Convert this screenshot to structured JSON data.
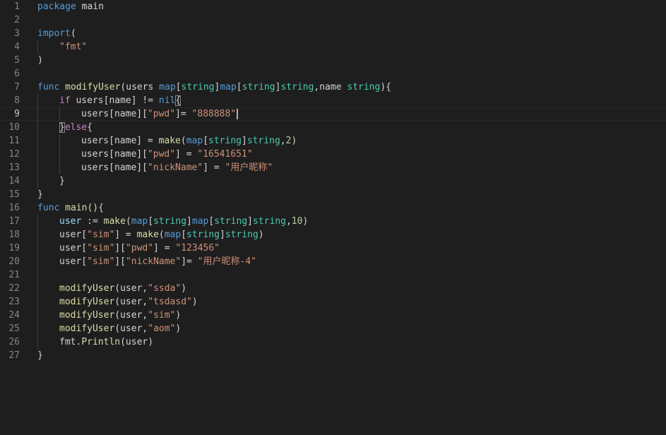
{
  "editor": {
    "current_line": 9,
    "lines": [
      {
        "no": "1",
        "indent": 0,
        "tokens": [
          {
            "t": "package",
            "c": "kw"
          },
          {
            "t": " main",
            "c": "plain"
          }
        ]
      },
      {
        "no": "2",
        "indent": 0,
        "tokens": []
      },
      {
        "no": "3",
        "indent": 0,
        "tokens": [
          {
            "t": "import",
            "c": "kw"
          },
          {
            "t": "(",
            "c": "plain"
          }
        ]
      },
      {
        "no": "4",
        "indent": 1,
        "tokens": [
          {
            "t": "\"fmt\"",
            "c": "str"
          }
        ]
      },
      {
        "no": "5",
        "indent": 0,
        "tokens": [
          {
            "t": ")",
            "c": "plain"
          }
        ]
      },
      {
        "no": "6",
        "indent": 0,
        "tokens": []
      },
      {
        "no": "7",
        "indent": 0,
        "tokens": [
          {
            "t": "func ",
            "c": "kw"
          },
          {
            "t": "modifyUser",
            "c": "fn"
          },
          {
            "t": "(",
            "c": "plain"
          },
          {
            "t": "users ",
            "c": "plain"
          },
          {
            "t": "map",
            "c": "kw"
          },
          {
            "t": "[",
            "c": "plain"
          },
          {
            "t": "string",
            "c": "ty"
          },
          {
            "t": "]",
            "c": "plain"
          },
          {
            "t": "map",
            "c": "kw"
          },
          {
            "t": "[",
            "c": "plain"
          },
          {
            "t": "string",
            "c": "ty"
          },
          {
            "t": "]",
            "c": "plain"
          },
          {
            "t": "string",
            "c": "ty"
          },
          {
            "t": ",name ",
            "c": "plain"
          },
          {
            "t": "string",
            "c": "ty"
          },
          {
            "t": "){",
            "c": "plain"
          }
        ]
      },
      {
        "no": "8",
        "indent": 1,
        "tokens": [
          {
            "t": "if ",
            "c": "ctl"
          },
          {
            "t": "users[name] != ",
            "c": "plain"
          },
          {
            "t": "nil",
            "c": "kw"
          },
          {
            "t": "{",
            "c": "plain",
            "m": true
          }
        ]
      },
      {
        "no": "9",
        "indent": 2,
        "cursor": true,
        "tokens": [
          {
            "t": "users[name][",
            "c": "plain"
          },
          {
            "t": "\"pwd\"",
            "c": "str"
          },
          {
            "t": "]= ",
            "c": "plain"
          },
          {
            "t": "\"888888\"",
            "c": "str"
          }
        ]
      },
      {
        "no": "10",
        "indent": 1,
        "tokens": [
          {
            "t": "}",
            "c": "plain",
            "m": true
          },
          {
            "t": "else",
            "c": "ctl"
          },
          {
            "t": "{",
            "c": "plain"
          }
        ]
      },
      {
        "no": "11",
        "indent": 2,
        "tokens": [
          {
            "t": "users[name] = ",
            "c": "plain"
          },
          {
            "t": "make",
            "c": "fn"
          },
          {
            "t": "(",
            "c": "plain"
          },
          {
            "t": "map",
            "c": "kw"
          },
          {
            "t": "[",
            "c": "plain"
          },
          {
            "t": "string",
            "c": "ty"
          },
          {
            "t": "]",
            "c": "plain"
          },
          {
            "t": "string",
            "c": "ty"
          },
          {
            "t": ",",
            "c": "plain"
          },
          {
            "t": "2",
            "c": "num"
          },
          {
            "t": ")",
            "c": "plain"
          }
        ]
      },
      {
        "no": "12",
        "indent": 2,
        "tokens": [
          {
            "t": "users[name][",
            "c": "plain"
          },
          {
            "t": "\"pwd\"",
            "c": "str"
          },
          {
            "t": "] = ",
            "c": "plain"
          },
          {
            "t": "\"16541651\"",
            "c": "str"
          }
        ]
      },
      {
        "no": "13",
        "indent": 2,
        "tokens": [
          {
            "t": "users[name][",
            "c": "plain"
          },
          {
            "t": "\"nickName\"",
            "c": "str"
          },
          {
            "t": "] = ",
            "c": "plain"
          },
          {
            "t": "\"用户昵称\"",
            "c": "str"
          }
        ]
      },
      {
        "no": "14",
        "indent": 1,
        "tokens": [
          {
            "t": "}",
            "c": "plain"
          }
        ]
      },
      {
        "no": "15",
        "indent": 0,
        "tokens": [
          {
            "t": "}",
            "c": "plain"
          }
        ]
      },
      {
        "no": "16",
        "indent": 0,
        "tokens": [
          {
            "t": "func ",
            "c": "kw"
          },
          {
            "t": "main",
            "c": "fn"
          },
          {
            "t": "(){",
            "c": "plain"
          }
        ]
      },
      {
        "no": "17",
        "indent": 1,
        "tokens": [
          {
            "t": "user",
            "c": "var"
          },
          {
            "t": " := ",
            "c": "plain"
          },
          {
            "t": "make",
            "c": "fn"
          },
          {
            "t": "(",
            "c": "plain"
          },
          {
            "t": "map",
            "c": "kw"
          },
          {
            "t": "[",
            "c": "plain"
          },
          {
            "t": "string",
            "c": "ty"
          },
          {
            "t": "]",
            "c": "plain"
          },
          {
            "t": "map",
            "c": "kw"
          },
          {
            "t": "[",
            "c": "plain"
          },
          {
            "t": "string",
            "c": "ty"
          },
          {
            "t": "]",
            "c": "plain"
          },
          {
            "t": "string",
            "c": "ty"
          },
          {
            "t": ",",
            "c": "plain"
          },
          {
            "t": "10",
            "c": "num"
          },
          {
            "t": ")",
            "c": "plain"
          }
        ]
      },
      {
        "no": "18",
        "indent": 1,
        "tokens": [
          {
            "t": "user[",
            "c": "plain"
          },
          {
            "t": "\"sim\"",
            "c": "str"
          },
          {
            "t": "] = ",
            "c": "plain"
          },
          {
            "t": "make",
            "c": "fn"
          },
          {
            "t": "(",
            "c": "plain"
          },
          {
            "t": "map",
            "c": "kw"
          },
          {
            "t": "[",
            "c": "plain"
          },
          {
            "t": "string",
            "c": "ty"
          },
          {
            "t": "]",
            "c": "plain"
          },
          {
            "t": "string",
            "c": "ty"
          },
          {
            "t": ")",
            "c": "plain"
          }
        ]
      },
      {
        "no": "19",
        "indent": 1,
        "tokens": [
          {
            "t": "user[",
            "c": "plain"
          },
          {
            "t": "\"sim\"",
            "c": "str"
          },
          {
            "t": "][",
            "c": "plain"
          },
          {
            "t": "\"pwd\"",
            "c": "str"
          },
          {
            "t": "] = ",
            "c": "plain"
          },
          {
            "t": "\"123456\"",
            "c": "str"
          }
        ]
      },
      {
        "no": "20",
        "indent": 1,
        "tokens": [
          {
            "t": "user[",
            "c": "plain"
          },
          {
            "t": "\"sim\"",
            "c": "str"
          },
          {
            "t": "][",
            "c": "plain"
          },
          {
            "t": "\"nickName\"",
            "c": "str"
          },
          {
            "t": "]= ",
            "c": "plain"
          },
          {
            "t": "\"用户昵称-4\"",
            "c": "str"
          }
        ]
      },
      {
        "no": "21",
        "indent": 1,
        "tokens": []
      },
      {
        "no": "22",
        "indent": 1,
        "tokens": [
          {
            "t": "modifyUser",
            "c": "fn"
          },
          {
            "t": "(user,",
            "c": "plain"
          },
          {
            "t": "\"ssda\"",
            "c": "str"
          },
          {
            "t": ")",
            "c": "plain"
          }
        ]
      },
      {
        "no": "23",
        "indent": 1,
        "tokens": [
          {
            "t": "modifyUser",
            "c": "fn"
          },
          {
            "t": "(user,",
            "c": "plain"
          },
          {
            "t": "\"tsdasd\"",
            "c": "str"
          },
          {
            "t": ")",
            "c": "plain"
          }
        ]
      },
      {
        "no": "24",
        "indent": 1,
        "tokens": [
          {
            "t": "modifyUser",
            "c": "fn"
          },
          {
            "t": "(user,",
            "c": "plain"
          },
          {
            "t": "\"sim\"",
            "c": "str"
          },
          {
            "t": ")",
            "c": "plain"
          }
        ]
      },
      {
        "no": "25",
        "indent": 1,
        "tokens": [
          {
            "t": "modifyUser",
            "c": "fn"
          },
          {
            "t": "(user,",
            "c": "plain"
          },
          {
            "t": "\"aom\"",
            "c": "str"
          },
          {
            "t": ")",
            "c": "plain"
          }
        ]
      },
      {
        "no": "26",
        "indent": 1,
        "tokens": [
          {
            "t": "fmt.",
            "c": "plain"
          },
          {
            "t": "Println",
            "c": "fn"
          },
          {
            "t": "(user)",
            "c": "plain"
          }
        ]
      },
      {
        "no": "27",
        "indent": 0,
        "tokens": [
          {
            "t": "}",
            "c": "plain"
          }
        ]
      }
    ]
  }
}
